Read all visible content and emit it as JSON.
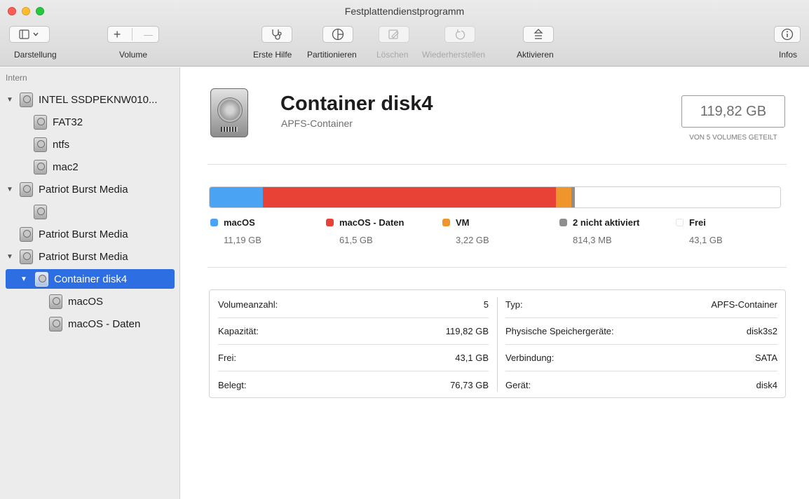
{
  "window": {
    "title": "Festplattendienstprogramm"
  },
  "toolbar": {
    "darstellung": "Darstellung",
    "volume": "Volume",
    "volume_add": "+",
    "volume_remove": "—",
    "erste_hilfe": "Erste Hilfe",
    "partitionieren": "Partitionieren",
    "loeschen": "Löschen",
    "wiederherstellen": "Wiederherstellen",
    "aktivieren": "Aktivieren",
    "infos": "Infos",
    "icons": {
      "darstellung": "sidebar-icon",
      "erste_hilfe": "stethoscope-icon",
      "partitionieren": "pie-icon",
      "loeschen": "erase-icon",
      "wiederherstellen": "restore-icon",
      "aktivieren": "eject-icon",
      "infos": "info-icon"
    }
  },
  "sidebar": {
    "section": "Intern",
    "items": [
      {
        "label": "INTEL SSDPEKNW010...",
        "level": 0,
        "expanded": true
      },
      {
        "label": "FAT32",
        "level": 1
      },
      {
        "label": "ntfs",
        "level": 1
      },
      {
        "label": "mac2",
        "level": 1
      },
      {
        "label": "Patriot Burst Media",
        "level": 0,
        "expanded": true
      },
      {
        "label": "",
        "level": 1
      },
      {
        "label": "Patriot Burst Media",
        "level": 0
      },
      {
        "label": "Patriot Burst Media",
        "level": 0,
        "expanded": true
      },
      {
        "label": "Container disk4",
        "level": 1,
        "expanded": true,
        "selected": true
      },
      {
        "label": "macOS",
        "level": 2
      },
      {
        "label": "macOS - Daten",
        "level": 2
      }
    ]
  },
  "main": {
    "title": "Container disk4",
    "subtitle": "APFS-Container",
    "capacity": "119,82 GB",
    "capacity_sub": "VON 5 VOLUMES GETEILT",
    "usage": [
      {
        "name": "macOS",
        "size": "11,19 GB",
        "gb": 11.19,
        "color": "#4ba3f3"
      },
      {
        "name": "macOS - Daten",
        "size": "61,5 GB",
        "gb": 61.5,
        "color": "#e84135"
      },
      {
        "name": "VM",
        "size": "3,22 GB",
        "gb": 3.22,
        "color": "#f0952b"
      },
      {
        "name": "2 nicht aktiviert",
        "size": "814,3 MB",
        "gb": 0.81,
        "color": "#8e8e8e"
      },
      {
        "name": "Frei",
        "size": "43,1 GB",
        "gb": 43.1,
        "color": "#ffffff"
      }
    ],
    "info_left": [
      {
        "label": "Volumeanzahl:",
        "value": "5"
      },
      {
        "label": "Kapazität:",
        "value": "119,82 GB"
      },
      {
        "label": "Frei:",
        "value": "43,1 GB"
      },
      {
        "label": "Belegt:",
        "value": "76,73 GB"
      }
    ],
    "info_right": [
      {
        "label": "Typ:",
        "value": "APFS-Container"
      },
      {
        "label": "Physische Speichergeräte:",
        "value": "disk3s2"
      },
      {
        "label": "Verbindung:",
        "value": "SATA"
      },
      {
        "label": "Gerät:",
        "value": "disk4"
      }
    ]
  }
}
